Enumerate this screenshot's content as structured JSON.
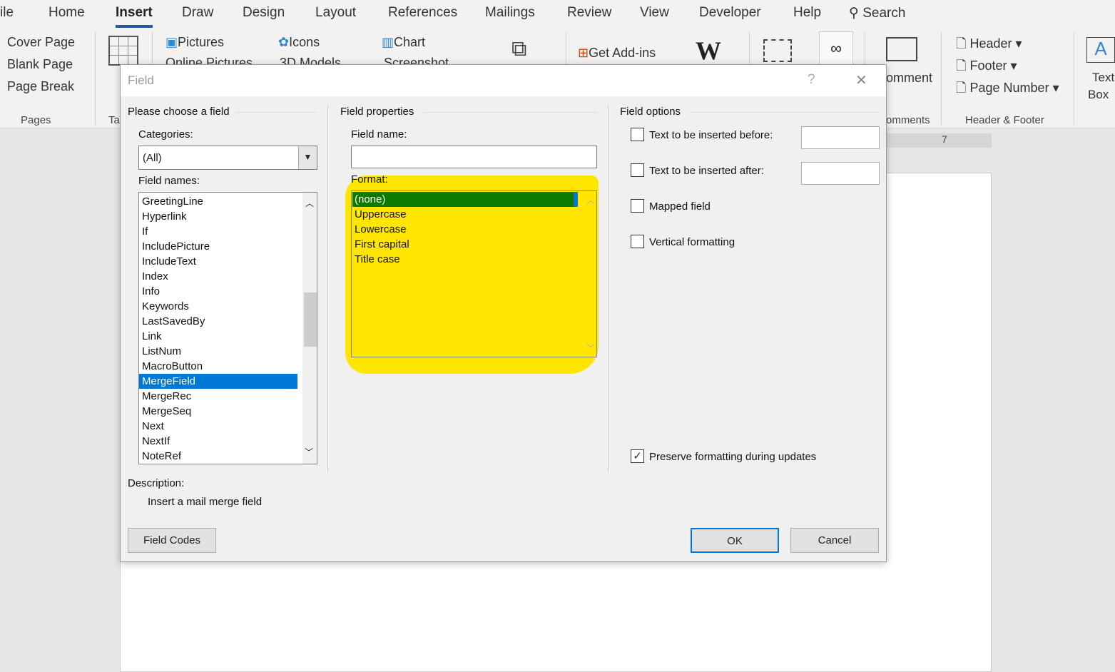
{
  "ribbon": {
    "tabs": [
      "ile",
      "Home",
      "Insert",
      "Draw",
      "Design",
      "Layout",
      "References",
      "Mailings",
      "Review",
      "View",
      "Developer",
      "Help"
    ],
    "active_tab": "Insert",
    "search": "Search",
    "pages": {
      "cover": "Cover Page",
      "blank": "Blank Page",
      "break": "Page Break",
      "group": "Pages"
    },
    "table_group": "Ta",
    "illustrations": {
      "pictures": "Pictures",
      "online": "Online Pictures",
      "icons": "Icons",
      "models": "3D Models",
      "chart": "Chart",
      "screenshot": "Screenshot"
    },
    "addins": "Get Add-ins",
    "comment": "omment",
    "comments_group": "omments",
    "header": "Header",
    "footer": "Footer",
    "page_number": "Page Number",
    "hf_group": "Header & Footer",
    "text_box": [
      "Text",
      "Box"
    ],
    "ruler_mark": "7"
  },
  "dialog": {
    "title": "Field",
    "help": "?",
    "close": "✕",
    "choose_title": "Please choose a field",
    "categories_label": "Categories:",
    "category_value": "(All)",
    "field_names_label": "Field names:",
    "field_names": [
      "GreetingLine",
      "Hyperlink",
      "If",
      "IncludePicture",
      "IncludeText",
      "Index",
      "Info",
      "Keywords",
      "LastSavedBy",
      "Link",
      "ListNum",
      "MacroButton",
      "MergeField",
      "MergeRec",
      "MergeSeq",
      "Next",
      "NextIf",
      "NoteRef"
    ],
    "selected_field": "MergeField",
    "props_title": "Field properties",
    "field_name_label": "Field name:",
    "field_name_value": "",
    "format_label": "Format:",
    "formats": [
      "(none)",
      "Uppercase",
      "Lowercase",
      "First capital",
      "Title case"
    ],
    "selected_format": "(none)",
    "highlight_color": "#ffe600",
    "options_title": "Field options",
    "opt_before": "Text to be inserted before:",
    "opt_after": "Text to be inserted after:",
    "opt_mapped": "Mapped field",
    "opt_vertical": "Vertical formatting",
    "opt_preserve": "Preserve formatting during updates",
    "preserve_checked": true,
    "description_label": "Description:",
    "description": "Insert a mail merge field",
    "field_codes": "Field Codes",
    "ok": "OK",
    "cancel": "Cancel"
  }
}
